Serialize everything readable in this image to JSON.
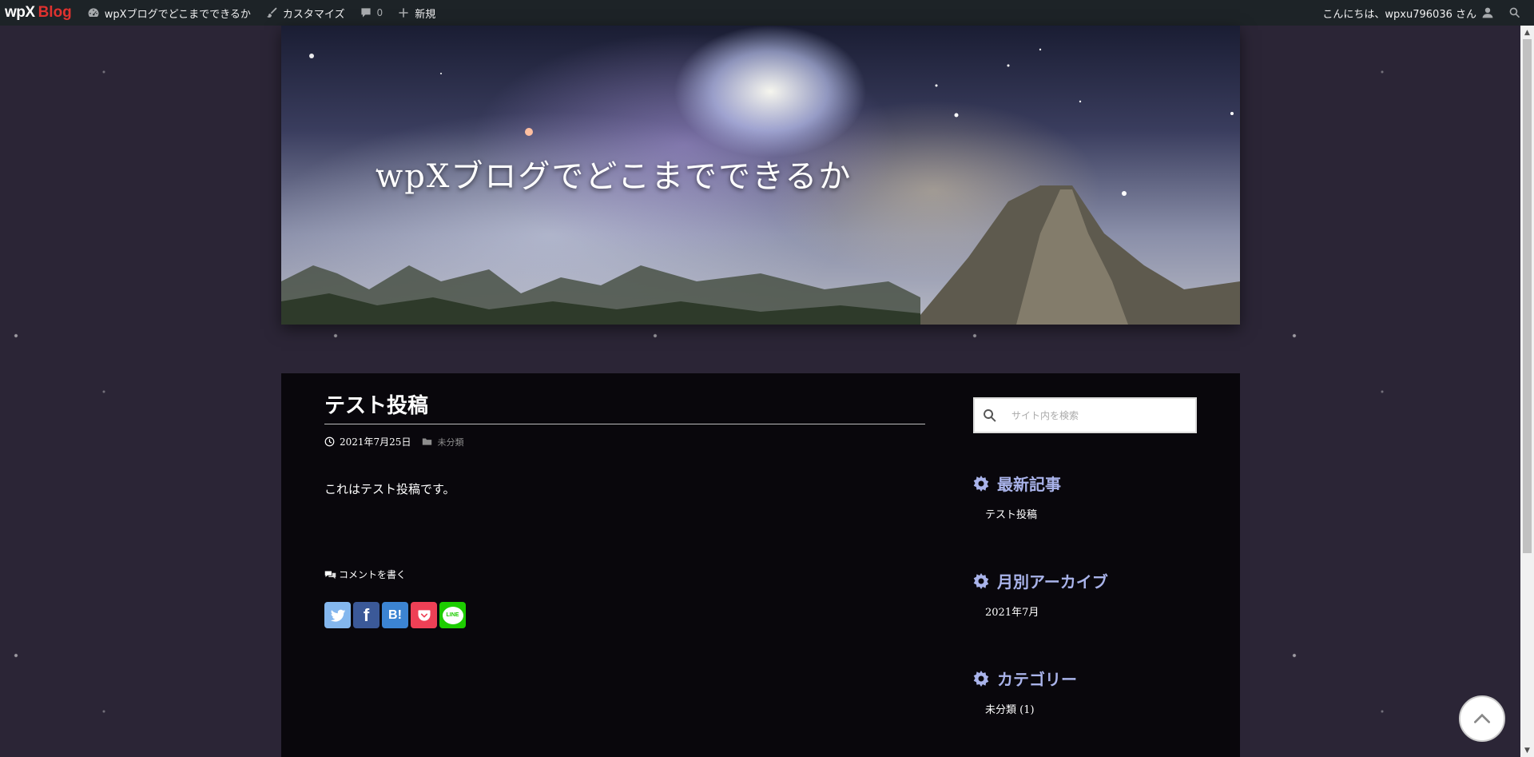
{
  "adminbar": {
    "logo_wpx": "wpX",
    "logo_blog": "Blog",
    "site_name": "wpXブログでどこまでできるか",
    "customize": "カスタマイズ",
    "comments_count": "0",
    "new": "新規",
    "greeting": "こんにちは、wpxu796036 さん"
  },
  "header": {
    "site_title": "wpXブログでどこまでできるか"
  },
  "post": {
    "title": "テスト投稿",
    "date": "2021年7月25日",
    "category": "未分類",
    "body": "これはテスト投稿です。",
    "comment_link": "コメントを書く"
  },
  "shares": [
    {
      "name": "twitter",
      "label": "",
      "color": "#84b7ee"
    },
    {
      "name": "facebook",
      "label": "f",
      "color": "#3b5998"
    },
    {
      "name": "hatena",
      "label": "B!",
      "color": "#3c84d2"
    },
    {
      "name": "pocket",
      "label": "",
      "color": "#ee4056"
    },
    {
      "name": "line",
      "label": "LINE",
      "color": "#1dcd00"
    }
  ],
  "sidebar": {
    "search_placeholder": "サイト内を検索",
    "recent_title": "最新記事",
    "recent_items": [
      "テスト投稿"
    ],
    "archive_title": "月別アーカイブ",
    "archive_items": [
      "2021年7月"
    ],
    "category_title": "カテゴリー",
    "category_items": [
      "未分類 (1)"
    ]
  },
  "colors": {
    "accent": "#a9b3ea",
    "admin_bg": "#1d2327",
    "page_bg": "#2b2536",
    "content_bg": "#09070c"
  }
}
